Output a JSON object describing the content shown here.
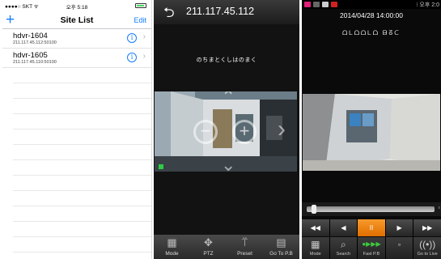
{
  "site_list": {
    "status": {
      "carrier": "●●●●○ SKT ᯤ",
      "time": "오후 5:18"
    },
    "title": "Site List",
    "add_label": "+",
    "edit_label": "Edit",
    "sites": [
      {
        "name": "hdvr-1604",
        "address": "211.117.45.112:50100"
      },
      {
        "name": "hdvr-1605",
        "address": "211.117.45.110:50100"
      }
    ],
    "info_glyph": "i",
    "chevron_glyph": "›"
  },
  "live_view": {
    "back_glyph": "⮌",
    "ip": "211.117.45.112",
    "osd_text": "のちまとくしはのまく",
    "ptz_arrows": {
      "up": "⌃",
      "down": "⌄",
      "right": "›"
    },
    "zoom_out": "−",
    "zoom_in": "+",
    "toolbar": [
      {
        "icon": "grid-icon",
        "glyph": "▦",
        "label": "Mode"
      },
      {
        "icon": "ptz-icon",
        "glyph": "✥",
        "label": "PTZ"
      },
      {
        "icon": "preset-icon",
        "glyph": "⍡",
        "label": "Preset"
      },
      {
        "icon": "playback-icon",
        "glyph": "▤",
        "label": "Go To P.B"
      }
    ]
  },
  "playback": {
    "status": {
      "right": "⁝ 오후 2:0"
    },
    "timestamp": "2014/04/28 14:00:00",
    "watermark": "ᗝᒪᗝᗝᒪᗝ ᗷᘔᑕ",
    "seek_position": 0.04,
    "seek_end_mark": "x",
    "controls": [
      {
        "name": "rewind-button",
        "glyph": "◀◀",
        "active": false
      },
      {
        "name": "step-back-button",
        "glyph": "◀",
        "active": false
      },
      {
        "name": "pause-button",
        "glyph": "II",
        "active": true
      },
      {
        "name": "play-button",
        "glyph": "▶",
        "active": false
      },
      {
        "name": "fast-forward-button",
        "glyph": "▶▶",
        "active": false
      }
    ],
    "bottom_bar": [
      {
        "icon": "grid-icon",
        "glyph": "▦",
        "label": "Mode"
      },
      {
        "icon": "search-icon",
        "glyph": "⌕",
        "label": "Search"
      },
      {
        "icon": "fast-playback-icon",
        "glyph": "●▶▶▶",
        "label": "Fast P.B"
      },
      {
        "icon": "signal-icon",
        "glyph": "◦",
        "label": ""
      },
      {
        "icon": "live-icon",
        "glyph": "((•))",
        "label": "Go to Live"
      }
    ]
  }
}
